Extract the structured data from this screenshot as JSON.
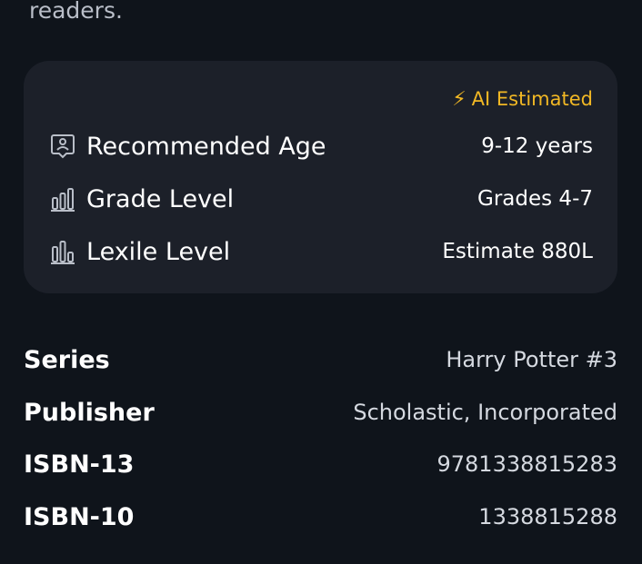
{
  "intro": {
    "tail_text": "readers."
  },
  "reading_card": {
    "badge": {
      "icon": "lightning-bolt-icon",
      "text": "AI Estimated",
      "color": "#f2b824"
    },
    "rows": [
      {
        "icon": "age-badge-icon",
        "label": "Recommended Age",
        "value": "9-12 years"
      },
      {
        "icon": "grade-bars-icon",
        "label": "Grade Level",
        "value": "Grades 4-7"
      },
      {
        "icon": "lexile-bars-icon",
        "label": "Lexile Level",
        "value": "Estimate 880L"
      }
    ]
  },
  "details": [
    {
      "label": "Series",
      "value": "Harry Potter #3"
    },
    {
      "label": "Publisher",
      "value": "Scholastic, Incorporated"
    },
    {
      "label": "ISBN-13",
      "value": "9781338815283"
    },
    {
      "label": "ISBN-10",
      "value": "1338815288"
    }
  ],
  "colors": {
    "background": "#0f141b",
    "card_background": "#1c2029",
    "accent": "#f2b824"
  }
}
